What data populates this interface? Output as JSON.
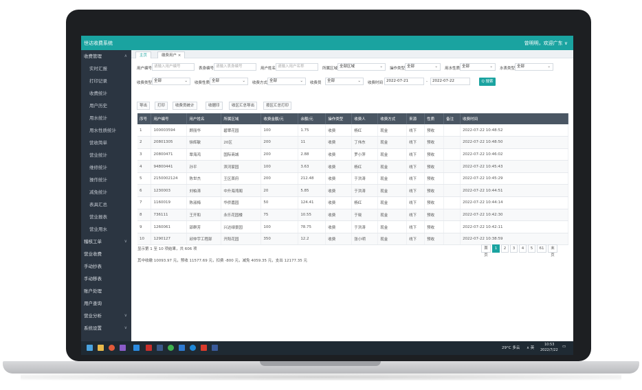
{
  "app": {
    "title": "世达收费系统",
    "user": "曾明明，欢迎广东 ∨"
  },
  "tabs": [
    {
      "label": "主页"
    },
    {
      "label": "缴费用户 ×"
    }
  ],
  "sidebar": {
    "items": [
      {
        "label": "收费管理",
        "type": "group",
        "chev": "∧"
      },
      {
        "label": "实时汇报",
        "type": "sub"
      },
      {
        "label": "打印记录",
        "type": "sub"
      },
      {
        "label": "收费统计",
        "type": "sub"
      },
      {
        "label": "用户历史",
        "type": "sub"
      },
      {
        "label": "用水统计",
        "type": "sub"
      },
      {
        "label": "用水性质统计",
        "type": "sub"
      },
      {
        "label": "营收简单",
        "type": "sub"
      },
      {
        "label": "营业统计",
        "type": "sub"
      },
      {
        "label": "维修统计",
        "type": "sub"
      },
      {
        "label": "操作统计",
        "type": "sub"
      },
      {
        "label": "减免统计",
        "type": "sub"
      },
      {
        "label": "表具汇总",
        "type": "sub"
      },
      {
        "label": "营业报表",
        "type": "sub"
      },
      {
        "label": "营业用水",
        "type": "sub"
      },
      {
        "label": "稽核工单",
        "type": "group",
        "chev": "∨"
      },
      {
        "label": "营业收费",
        "type": "group"
      },
      {
        "label": "手动抄表",
        "type": "group"
      },
      {
        "label": "手动移表",
        "type": "group"
      },
      {
        "label": "账户处理",
        "type": "group"
      },
      {
        "label": "用户查询",
        "type": "group"
      },
      {
        "label": "营业分析",
        "type": "group",
        "chev": "∨"
      },
      {
        "label": "系统设置",
        "type": "group",
        "chev": "∨"
      }
    ]
  },
  "filters": {
    "row1": [
      {
        "label": "用户编号",
        "placeholder": "请输入用户编号"
      },
      {
        "label": "表身编号",
        "placeholder": "请输入表身编号"
      },
      {
        "label": "用户姓名",
        "placeholder": "请输入用户名称"
      },
      {
        "label": "所属区域",
        "value": "全部区域"
      },
      {
        "label": "操作类型",
        "value": "全部"
      },
      {
        "label": "用水性质",
        "value": "全部"
      },
      {
        "label": "水表类型",
        "value": "全部"
      }
    ],
    "row2": [
      {
        "label": "收费类型",
        "value": "全部"
      },
      {
        "label": "收费性质",
        "value": "全部"
      },
      {
        "label": "收费方式",
        "value": "全部"
      },
      {
        "label": "收费员",
        "value": "全部"
      },
      {
        "label": "收费时间",
        "from": "2022-07-21",
        "sep": "-",
        "to": "2022-07-22"
      }
    ],
    "search_label": "Q 搜索"
  },
  "toolbar": {
    "buttons": [
      {
        "label": "导出"
      },
      {
        "label": "打印"
      },
      {
        "label": "收费员统计"
      },
      {
        "label": "收据印"
      },
      {
        "label": "收区汇总导出"
      },
      {
        "label": "按区汇总打印"
      }
    ]
  },
  "table": {
    "headers": [
      "序号",
      "用户编号",
      "用户姓名",
      "所属区域",
      "收费金额/元",
      "余额/元",
      "操作类型",
      "收费人",
      "收费方式",
      "来源",
      "性质",
      "备注",
      "收费时间"
    ],
    "rows": [
      [
        "1",
        "100003594",
        "顾丽华",
        "碧翠花园",
        "100",
        "1.75",
        "收费",
        "杨红",
        "现金",
        "线下",
        "预收",
        "",
        "2022-07-22 10:48:52"
      ],
      [
        "2",
        "20801305",
        "徐辉敏",
        "20区",
        "200",
        "11",
        "收费",
        "丁伟东",
        "现金",
        "线下",
        "预收",
        "",
        "2022-07-22 10:48:50"
      ],
      [
        "3",
        "20800471",
        "覃海鸿",
        "国际商城",
        "200",
        "2.88",
        "收费",
        "罗小萍",
        "现金",
        "线下",
        "预收",
        "",
        "2022-07-22 10:46:02"
      ],
      [
        "4",
        "94800441",
        "孙平",
        "滨河家园",
        "100",
        "3.63",
        "收费",
        "杨红",
        "现金",
        "线下",
        "预收",
        "",
        "2022-07-22 10:45:43"
      ],
      [
        "5",
        "2150002124",
        "陈世杰",
        "王区首府",
        "200",
        "212.48",
        "收费",
        "于洪涛",
        "现金",
        "线下",
        "预收",
        "",
        "2022-07-22 10:45:29"
      ],
      [
        "6",
        "1230003",
        "刘柏涛",
        "中升海湾阁",
        "20",
        "5.85",
        "收费",
        "于洪涛",
        "现金",
        "线下",
        "预收",
        "",
        "2022-07-22 10:44:51"
      ],
      [
        "7",
        "1160019",
        "陈淑梅",
        "华侨嘉园",
        "50",
        "124.41",
        "收费",
        "杨红",
        "现金",
        "线下",
        "预收",
        "",
        "2022-07-22 10:44:14"
      ],
      [
        "8",
        "736111",
        "王开和",
        "永乐花园楼",
        "75",
        "10.55",
        "收费",
        "于晓",
        "现金",
        "线下",
        "预收",
        "",
        "2022-07-22 10:42:30"
      ],
      [
        "9",
        "1260061",
        "邵群芳",
        "兴达绿景园",
        "100",
        "78.75",
        "收费",
        "于洪涛",
        "现金",
        "线下",
        "预收",
        "",
        "2022-07-22 10:42:11"
      ],
      [
        "10",
        "1290127",
        "邱仲宇工程部",
        "开阳花园",
        "350",
        "12.2",
        "收费",
        "张小明",
        "现金",
        "线下",
        "预收",
        "",
        "2022-07-22 10:38:59"
      ]
    ]
  },
  "pager": {
    "info": "显示第 1 至 10 项结果，共 606 项",
    "buttons": [
      "首页",
      "1",
      "2",
      "3",
      "4",
      "5",
      "61",
      "末页"
    ],
    "active": "1"
  },
  "summary": "其中收缴 10093.97 元，预收 11577.69 元，扣费 -800 元，减免 4059.35 元，支出 12177.35 元",
  "taskbar": {
    "weather": "29°C 多云",
    "ime": "∧ 英",
    "time": "10:53",
    "date": "2022/7/22"
  },
  "colors": {
    "accent": "#1aa3a0",
    "sidebar": "#2b3541",
    "table_header": "#4a5663",
    "bezel": "#1d1f22"
  }
}
